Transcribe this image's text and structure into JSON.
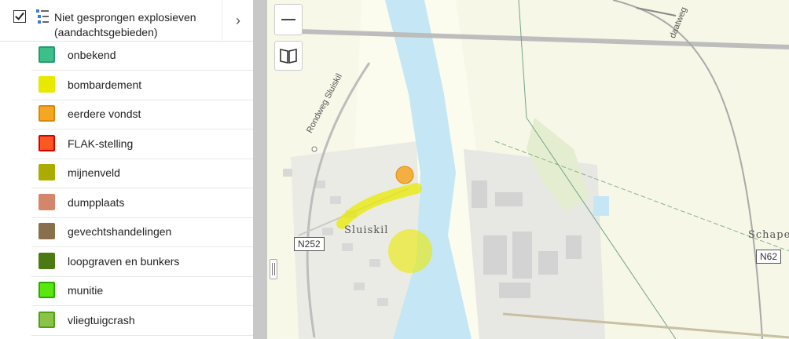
{
  "layer": {
    "checked": true,
    "title": "Niet gesprongen explosieven (aandachtsgebieden)",
    "icon": "legend-list-icon",
    "expand_icon": "chevron-right-icon"
  },
  "legend": [
    {
      "label": "onbekend",
      "fill": "#3cbf8a",
      "border": "#2a9a6c"
    },
    {
      "label": "bombardement",
      "fill": "#e9e900",
      "border": "#e9e900"
    },
    {
      "label": "eerdere vondst",
      "fill": "#f5a623",
      "border": "#d98a0b"
    },
    {
      "label": "FLAK-stelling",
      "fill": "#ff5722",
      "border": "#d80000"
    },
    {
      "label": "mijnenveld",
      "fill": "#abab00",
      "border": "#abab00"
    },
    {
      "label": "dumpplaats",
      "fill": "#d4866a",
      "border": "#d4866a"
    },
    {
      "label": "gevechtshandelingen",
      "fill": "#8a6f4e",
      "border": "#8a6f4e"
    },
    {
      "label": "loopgraven en bunkers",
      "fill": "#4b7a12",
      "border": "#4b7a12"
    },
    {
      "label": "munitie",
      "fill": "#58e80e",
      "border": "#2fa800"
    },
    {
      "label": "vliegtuigcrash",
      "fill": "#8bc34a",
      "border": "#4fa012"
    }
  ],
  "map": {
    "labels": {
      "town1": "Sluiskil",
      "town2": "Schapen",
      "road1": "N252",
      "road2": "N62",
      "street1": "Rondweg Sluiskil",
      "street2": "daatweg"
    },
    "colors": {
      "water": "#c5e6f5",
      "bomb": "#e9e900",
      "find": "#f5a623"
    }
  },
  "controls": {
    "zoom_out_icon": "minus-icon",
    "bookmark_icon": "open-book-icon"
  }
}
